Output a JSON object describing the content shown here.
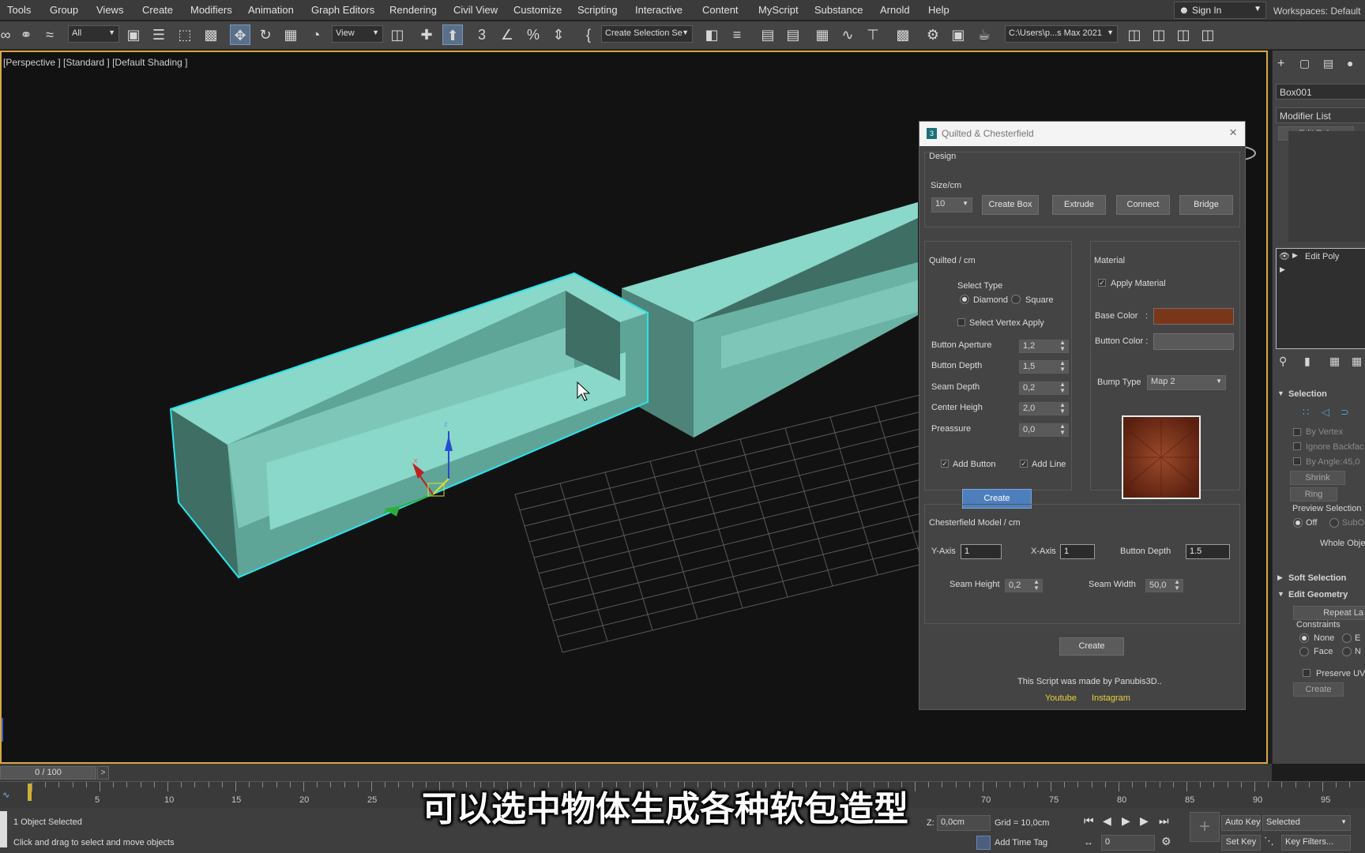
{
  "menu": [
    "Tools",
    "Group",
    "Views",
    "Create",
    "Modifiers",
    "Animation",
    "Graph Editors",
    "Rendering",
    "Civil View",
    "Customize",
    "Scripting",
    "Interactive",
    "Content",
    "MyScript",
    "Substance",
    "Arnold",
    "Help"
  ],
  "signin": "Sign In",
  "workspaces": "Workspaces:  Default",
  "toolbar": {
    "filter": "All",
    "refcoord": "View",
    "selset": "Create Selection Se",
    "path": "C:\\Users\\p...s Max 2021"
  },
  "viewport": {
    "label": "[Perspective ] [Standard ] [Default Shading ]"
  },
  "dialog": {
    "title": "Quilted & Chesterfield",
    "design_label": "Design",
    "size_label": "Size/cm",
    "size_value": "10",
    "buttons": {
      "create_box": "Create Box",
      "extrude": "Extrude",
      "connect": "Connect",
      "bridge": "Bridge"
    },
    "quilted": {
      "label": "Quilted / cm",
      "select_type": "Select Type",
      "diamond": "Diamond",
      "square": "Square",
      "select_vertex": "Select Vertex Apply",
      "params": [
        {
          "label": "Button Aperture",
          "value": "1,2"
        },
        {
          "label": "Button Depth",
          "value": "1,5"
        },
        {
          "label": "Seam Depth",
          "value": "0,2"
        },
        {
          "label": "Center Heigh",
          "value": "2,0"
        },
        {
          "label": "Preassure",
          "value": "0,0"
        }
      ],
      "add_button": "Add Button",
      "add_line": "Add Line",
      "create": "Create"
    },
    "material": {
      "label": "Material",
      "apply": "Apply Material",
      "base_color": "Base Color",
      "button_color": "Button Color :",
      "base_color_hex": "#7a3618",
      "button_color_hex": "#595959",
      "bump_type": "Bump Type",
      "bump_value": "Map 2"
    },
    "chesterfield": {
      "label": "Chesterfield Model / cm",
      "y_axis": "Y-Axis",
      "y_value": "1",
      "x_axis": "X-Axis",
      "x_value": "1",
      "button_depth": "Button Depth",
      "button_depth_value": "1.5",
      "seam_height": "Seam Height",
      "seam_height_value": "0,2",
      "seam_width": "Seam Width",
      "seam_width_value": "50,0",
      "create": "Create"
    },
    "footer": "This Script was made by Panubis3D..",
    "youtube": "Youtube",
    "instagram": "Instagram"
  },
  "command_panel": {
    "object_name": "Box001",
    "modifier_list": "Modifier List",
    "edit_poly_top": "Edit Poly",
    "stack_item": "Edit Poly",
    "selection": "Selection",
    "by_vertex": "By Vertex",
    "ignore_backface": "Ignore Backfac",
    "by_angle": "By Angle:",
    "by_angle_value": "45,0",
    "shrink": "Shrink",
    "ring": "Ring",
    "preview_selection": "Preview Selection",
    "off": "Off",
    "subobj": "SubO",
    "whole_object": "Whole Obje",
    "soft_selection": "Soft Selection",
    "edit_geometry": "Edit Geometry",
    "repeat_last": "Repeat La",
    "constraints": "Constraints",
    "none": "None",
    "face": "Face",
    "constraint_e": "E",
    "constraint_n": "N",
    "preserve_uvs": "Preserve UVs",
    "create": "Create"
  },
  "timeline": {
    "frame": "0 / 100",
    "next": ">",
    "ticks": [
      "5",
      "10",
      "15",
      "20",
      "25",
      "70",
      "75",
      "80",
      "85",
      "90",
      "95"
    ]
  },
  "status": {
    "selected": "1 Object Selected",
    "hint": "Click and drag to select and move objects",
    "z_label": "Z:",
    "z_value": "0,0cm",
    "grid": "Grid = 10,0cm",
    "add_time_tag": "Add Time Tag",
    "frame_value": "0",
    "auto_key": "Auto Key",
    "selected_dd": "Selected",
    "set_key": "Set Key",
    "key_filters": "Key Filters..."
  },
  "subtitle": "可以选中物体生成各种软包造型",
  "colors": {
    "sofa_top": "#89d8c9",
    "sofa_front": "#5fa597",
    "sofa_dark": "#3f6e65",
    "selection": "#29e4ee",
    "accent": "#4e7fbd",
    "link": "#e8d23a"
  }
}
